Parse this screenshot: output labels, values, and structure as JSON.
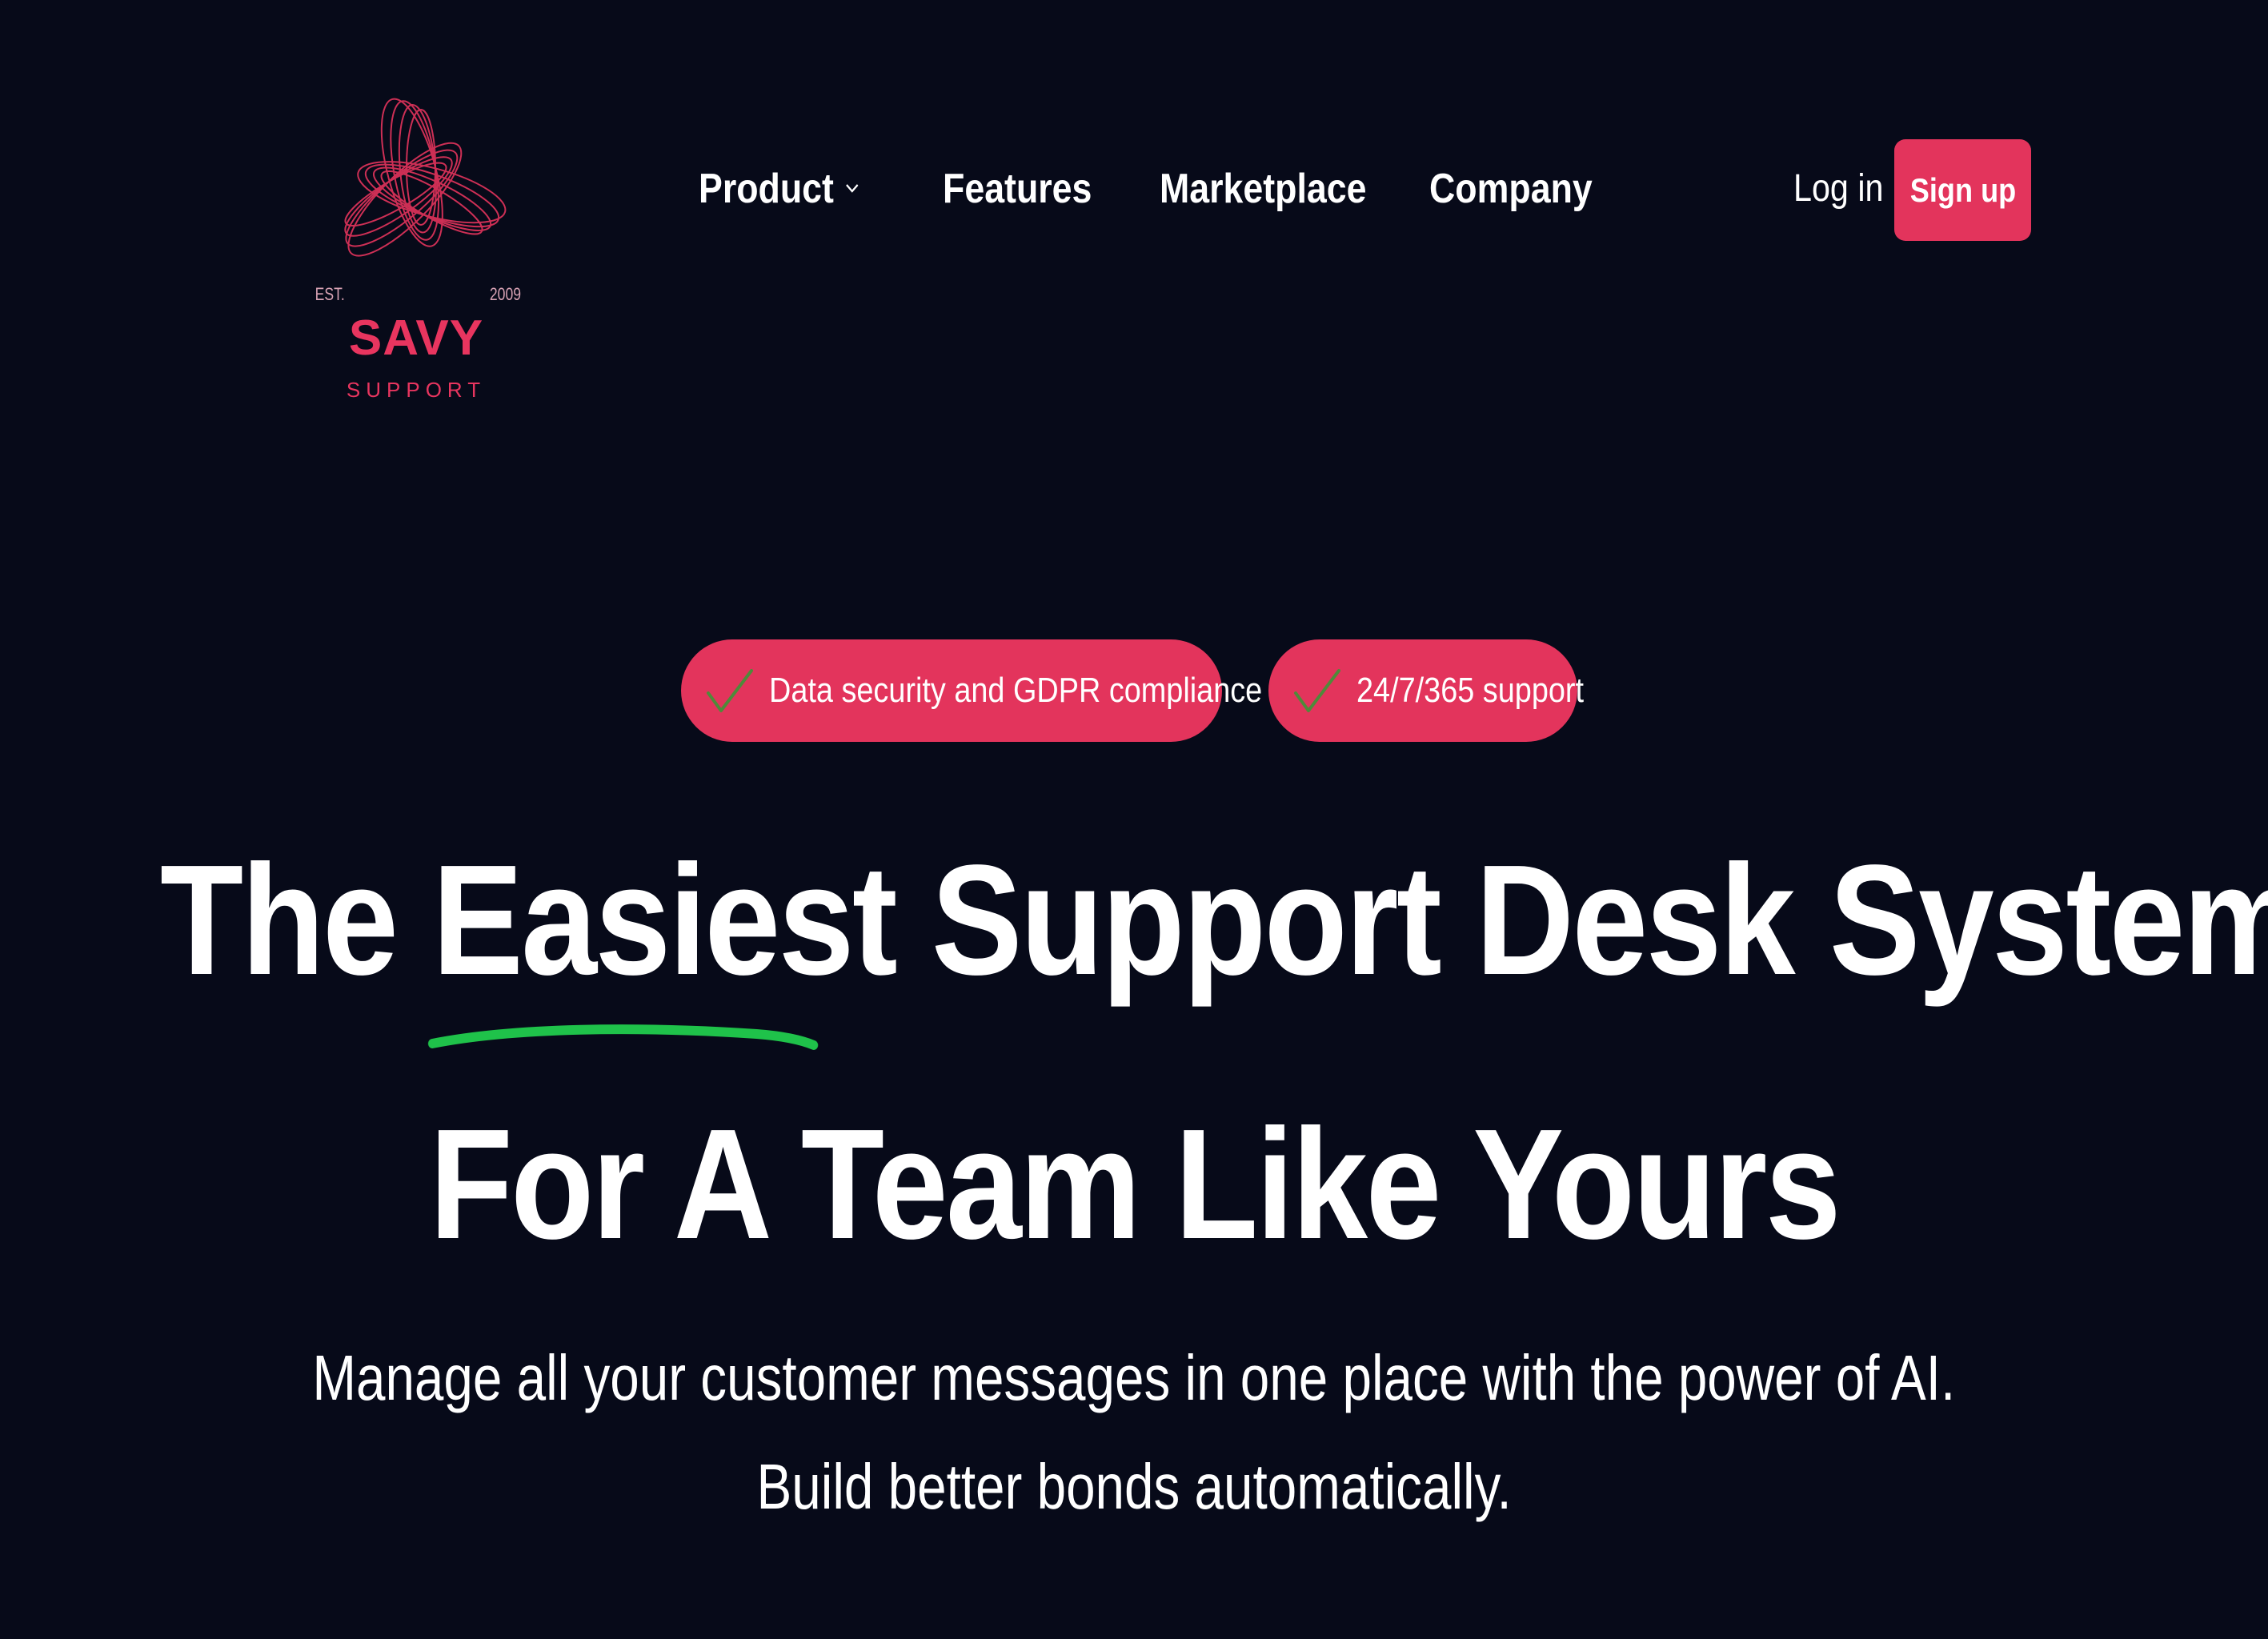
{
  "brand": {
    "est_label": "EST.",
    "year": "2009",
    "name": "SAVY",
    "tagline": "SUPPORT",
    "accent_color": "#e3345c"
  },
  "nav": {
    "items": [
      {
        "label": "Product",
        "has_dropdown": true
      },
      {
        "label": "Features"
      },
      {
        "label": "Marketplace"
      },
      {
        "label": "Company"
      }
    ],
    "login_label": "Log in",
    "signup_label": "Sign up"
  },
  "badges": [
    {
      "icon": "checkmark-icon",
      "label": "Data security and GDPR compliance"
    },
    {
      "icon": "checkmark-icon",
      "label": "24/7/365 support"
    }
  ],
  "hero": {
    "headline_pre": "The ",
    "headline_emphasis": "Easiest",
    "headline_post": " Support Desk System",
    "headline_line2": "For A Team Like Yours",
    "subtext_line1": "Manage all your customer messages in one place with the power of AI.",
    "subtext_line2": "Build better bonds automatically.",
    "underline_color": "#1fc24a"
  },
  "colors": {
    "background": "#070a19",
    "check_color": "#4f8a3a"
  }
}
